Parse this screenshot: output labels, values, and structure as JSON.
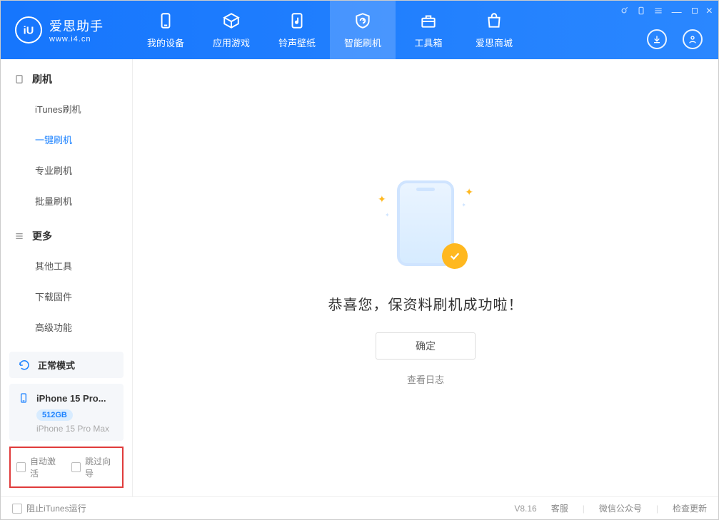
{
  "app": {
    "name": "爱思助手",
    "url": "www.i4.cn"
  },
  "nav": {
    "tabs": [
      {
        "label": "我的设备"
      },
      {
        "label": "应用游戏"
      },
      {
        "label": "铃声壁纸"
      },
      {
        "label": "智能刷机"
      },
      {
        "label": "工具箱"
      },
      {
        "label": "爱思商城"
      }
    ]
  },
  "sidebar": {
    "section1": {
      "title": "刷机",
      "items": [
        {
          "label": "iTunes刷机"
        },
        {
          "label": "一键刷机"
        },
        {
          "label": "专业刷机"
        },
        {
          "label": "批量刷机"
        }
      ]
    },
    "section2": {
      "title": "更多",
      "items": [
        {
          "label": "其他工具"
        },
        {
          "label": "下载固件"
        },
        {
          "label": "高级功能"
        }
      ]
    },
    "status": {
      "label": "正常模式"
    },
    "device": {
      "name": "iPhone 15 Pro...",
      "storage": "512GB",
      "model": "iPhone 15 Pro Max"
    },
    "options": {
      "auto_activate": "自动激活",
      "skip_wizard": "跳过向导"
    }
  },
  "main": {
    "success_text": "恭喜您，保资料刷机成功啦！",
    "ok_button": "确定",
    "view_log": "查看日志"
  },
  "footer": {
    "block_itunes": "阻止iTunes运行",
    "version": "V8.16",
    "links": {
      "support": "客服",
      "wechat": "微信公众号",
      "update": "检查更新"
    }
  }
}
